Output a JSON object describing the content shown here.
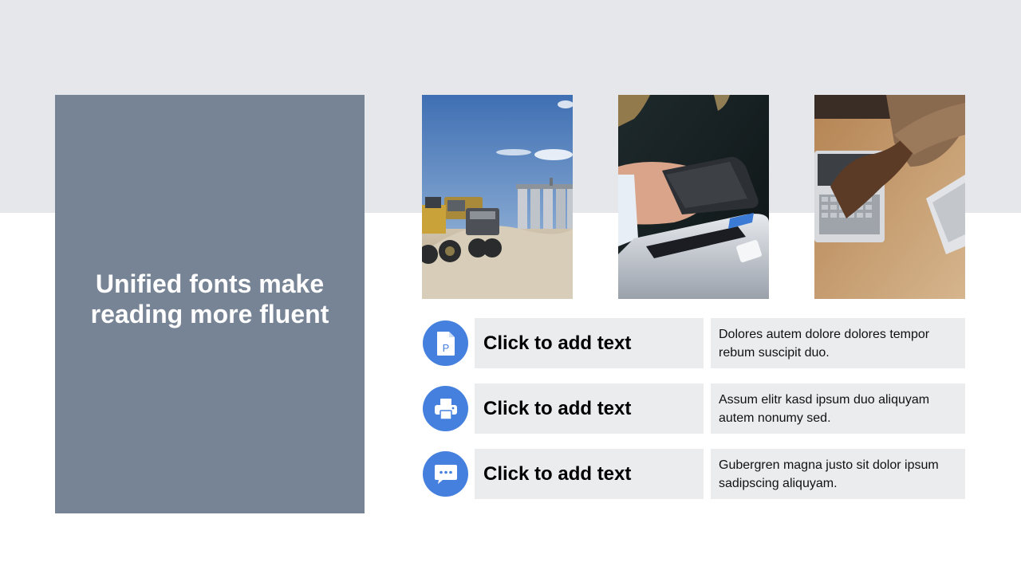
{
  "slide": {
    "title": "Unified fonts make reading more fluent",
    "colors": {
      "top_band": "#e6e7eb",
      "title_panel": "#778495",
      "icon_accent": "#4580de",
      "row_box": "#ebecee"
    }
  },
  "photos": [
    {
      "subject": "construction-truck-and-silos"
    },
    {
      "subject": "card-payment-terminal"
    },
    {
      "subject": "hands-typing-on-laptop"
    }
  ],
  "items": [
    {
      "icon": "document-icon",
      "title": "Click to add text",
      "description": "Dolores autem dolore dolores tempor rebum suscipit duo."
    },
    {
      "icon": "printer-icon",
      "title": "Click to add text",
      "description": "Assum elitr kasd ipsum duo aliquyam autem nonumy sed."
    },
    {
      "icon": "chat-bubble-icon",
      "title": "Click to add text",
      "description": "Gubergren magna justo sit dolor ipsum sadipscing aliquyam."
    }
  ]
}
